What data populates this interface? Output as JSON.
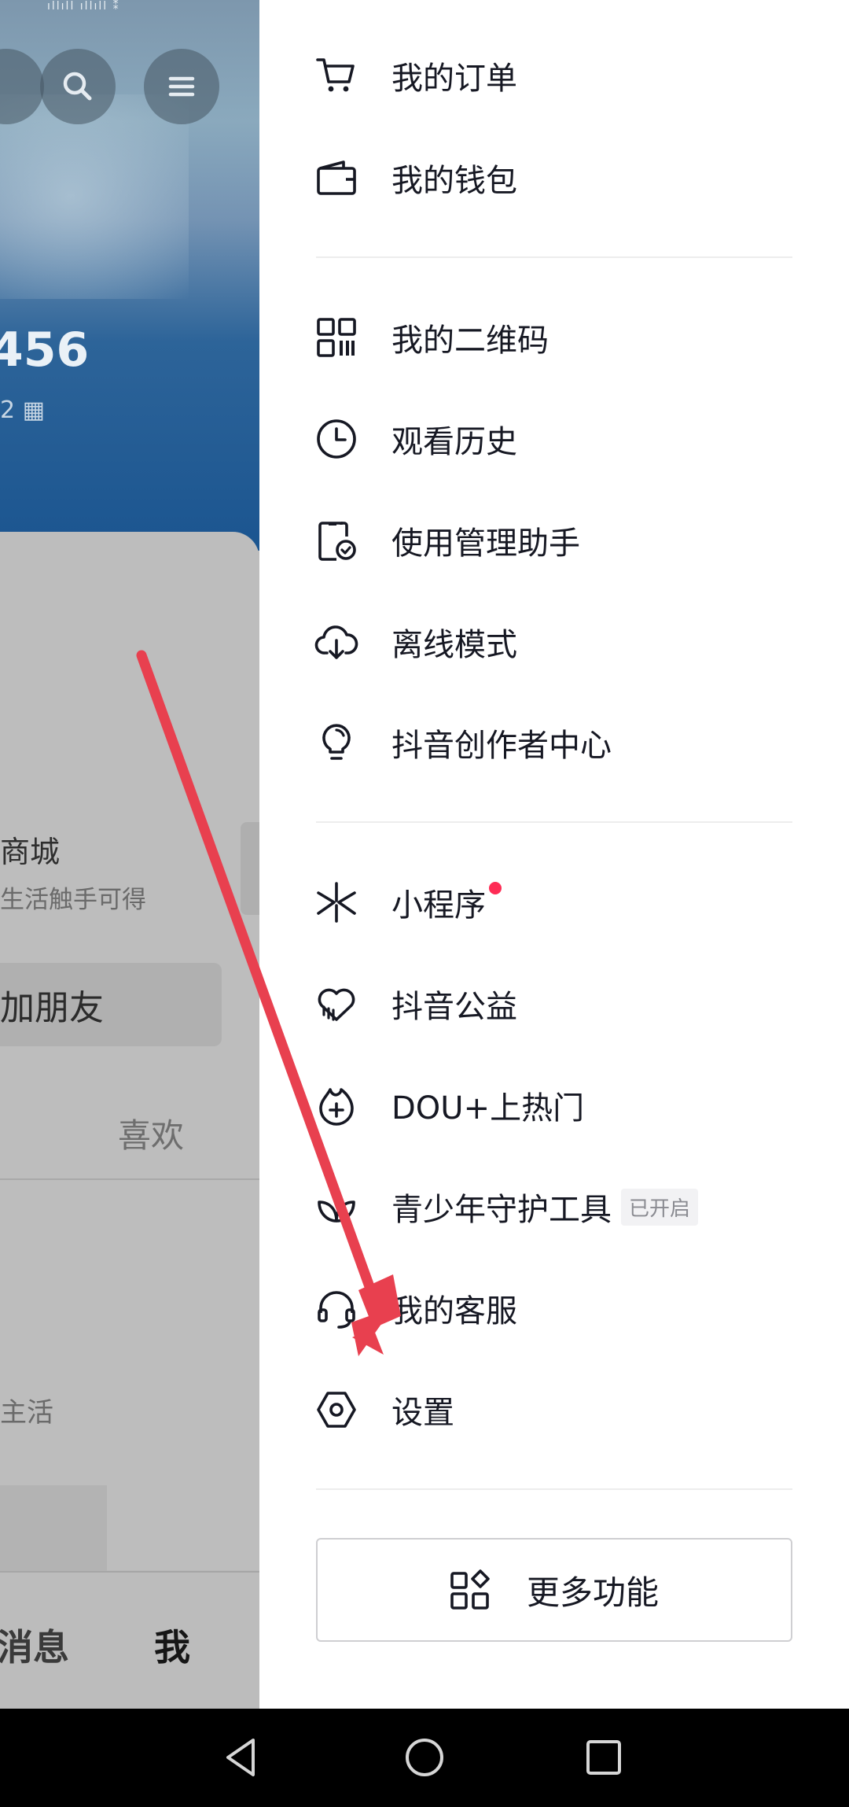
{
  "background": {
    "status_glyphs": "ıllıll ıllıll ⁑",
    "stat_value": "456",
    "stat_sub": "2 ▦",
    "mall_title": "商城",
    "mall_subtitle": "生活触手可得",
    "add_friend": "加朋友",
    "likes_tab": "喜欢",
    "life_text": "主活",
    "nav_messages": "消息",
    "nav_me": "我"
  },
  "drawer": {
    "group1": [
      {
        "label": "我的订单",
        "icon": "shopping-cart-icon"
      },
      {
        "label": "我的钱包",
        "icon": "wallet-icon"
      }
    ],
    "group2": [
      {
        "label": "我的二维码",
        "icon": "qr-code-icon"
      },
      {
        "label": "观看历史",
        "icon": "clock-icon"
      },
      {
        "label": "使用管理助手",
        "icon": "phone-check-icon"
      },
      {
        "label": "离线模式",
        "icon": "cloud-download-icon"
      },
      {
        "label": "抖音创作者中心",
        "icon": "lightbulb-icon"
      }
    ],
    "group3": [
      {
        "label": "小程序",
        "icon": "mini-program-icon",
        "has_red_dot": true
      },
      {
        "label": "抖音公益",
        "icon": "heart-charity-icon"
      },
      {
        "label": "DOU+上热门",
        "icon": "flame-plus-icon"
      },
      {
        "label": "青少年守护工具",
        "icon": "leaf-icon",
        "badge": "已开启"
      },
      {
        "label": "我的客服",
        "icon": "headset-icon"
      },
      {
        "label": "设置",
        "icon": "hexagon-settings-icon"
      }
    ],
    "more_button": {
      "label": "更多功能",
      "icon": "grid-apps-icon"
    }
  },
  "colors": {
    "accent_red": "#fe2c55",
    "arrow_red": "#e8404f",
    "text_primary": "#161823"
  },
  "system_nav": {
    "back": "back-triangle-icon",
    "home": "home-circle-icon",
    "recents": "recents-square-icon"
  }
}
